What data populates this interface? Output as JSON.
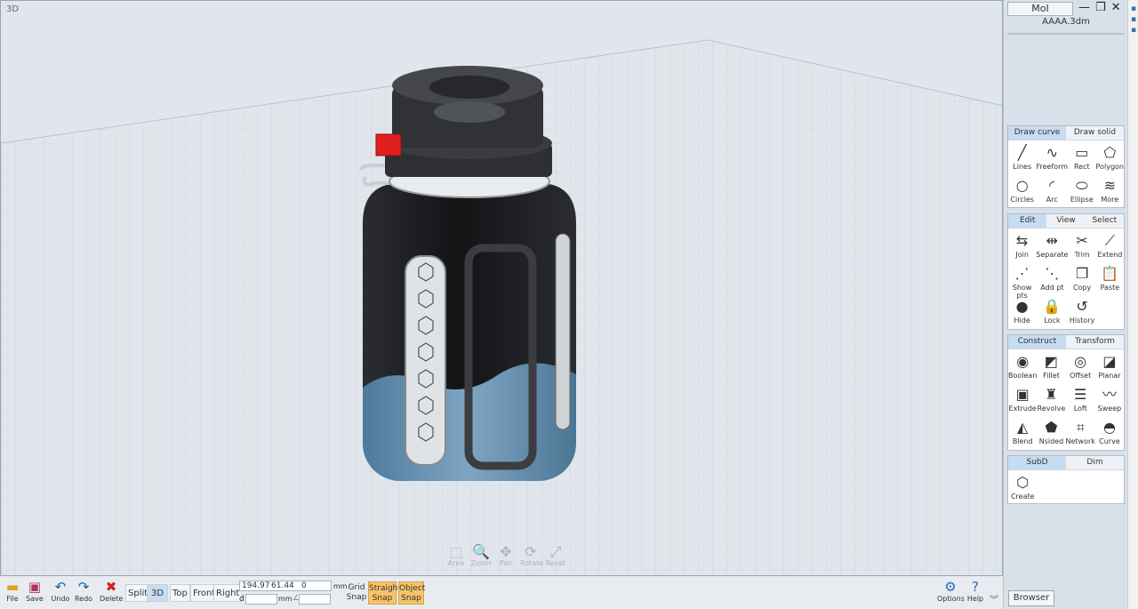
{
  "viewport": {
    "label": "3D"
  },
  "nav_tools": [
    {
      "id": "area",
      "label": "Area",
      "glyph": "⬚"
    },
    {
      "id": "zoom",
      "label": "Zoom",
      "glyph": "🔍"
    },
    {
      "id": "pan",
      "label": "Pan",
      "glyph": "✥"
    },
    {
      "id": "rotate",
      "label": "Rotate",
      "glyph": "⟳"
    },
    {
      "id": "reset",
      "label": "Reset",
      "glyph": "⤢"
    }
  ],
  "bottom": {
    "file": "File",
    "save": "Save",
    "undo": "Undo",
    "redo": "Redo",
    "delete": "Delete",
    "views": [
      "Split",
      "3D",
      "Top",
      "Front",
      "Right"
    ],
    "active_view": "3D",
    "coord_x": "194.97",
    "coord_y": "61.44",
    "coord_z": "0",
    "unit": "mm",
    "d_label": "d",
    "d_unit": "mm",
    "angle_symbol": "∠",
    "grid_snap": [
      "Grid",
      "Snap"
    ],
    "straight_snap": [
      "Straight",
      "Snap"
    ],
    "object_snap": [
      "Object",
      "Snap"
    ],
    "options": "Options",
    "help": "Help"
  },
  "side": {
    "app_title": "MoI",
    "filename": "AAAA.3dm",
    "draw": {
      "tabs": [
        "Draw curve",
        "Draw solid"
      ],
      "active": 0,
      "tools": [
        {
          "label": "Lines",
          "icon": "lines-icon",
          "glyph": "╱"
        },
        {
          "label": "Freeform",
          "icon": "freeform-icon",
          "glyph": "∿"
        },
        {
          "label": "Rect",
          "icon": "rect-icon",
          "glyph": "▭"
        },
        {
          "label": "Polygon",
          "icon": "polygon-icon",
          "glyph": "⬠"
        },
        {
          "label": "Circles",
          "icon": "circle-icon",
          "glyph": "○"
        },
        {
          "label": "Arc",
          "icon": "arc-icon",
          "glyph": "◜"
        },
        {
          "label": "Ellipse",
          "icon": "ellipse-icon",
          "glyph": "⬭"
        },
        {
          "label": "More",
          "icon": "more-icon",
          "glyph": "≋"
        }
      ]
    },
    "edit": {
      "tabs": [
        "Edit",
        "View",
        "Select"
      ],
      "active": 0,
      "tools": [
        {
          "label": "Join",
          "icon": "join-icon",
          "glyph": "⇆"
        },
        {
          "label": "Separate",
          "icon": "separate-icon",
          "glyph": "⇹"
        },
        {
          "label": "Trim",
          "icon": "trim-icon",
          "glyph": "✂"
        },
        {
          "label": "Extend",
          "icon": "extend-icon",
          "glyph": "⟋"
        },
        {
          "label": "Show pts",
          "icon": "show-points-icon",
          "glyph": "⋰"
        },
        {
          "label": "Add pt",
          "icon": "add-point-icon",
          "glyph": "⋱"
        },
        {
          "label": "Copy",
          "icon": "copy-icon",
          "glyph": "❐"
        },
        {
          "label": "Paste",
          "icon": "paste-icon",
          "glyph": "📋"
        },
        {
          "label": "Hide",
          "icon": "hide-icon",
          "glyph": "●"
        },
        {
          "label": "Lock",
          "icon": "lock-icon",
          "glyph": "🔒"
        },
        {
          "label": "History",
          "icon": "history-icon",
          "glyph": "↺"
        }
      ]
    },
    "construct": {
      "tabs": [
        "Construct",
        "Transform"
      ],
      "active": 0,
      "tools": [
        {
          "label": "Boolean",
          "icon": "boolean-icon",
          "glyph": "◉"
        },
        {
          "label": "Fillet",
          "icon": "fillet-icon",
          "glyph": "◩"
        },
        {
          "label": "Offset",
          "icon": "offset-icon",
          "glyph": "◎"
        },
        {
          "label": "Planar",
          "icon": "planar-icon",
          "glyph": "◪"
        },
        {
          "label": "Extrude",
          "icon": "extrude-icon",
          "glyph": "▣"
        },
        {
          "label": "Revolve",
          "icon": "revolve-icon",
          "glyph": "♜"
        },
        {
          "label": "Loft",
          "icon": "loft-icon",
          "glyph": "☰"
        },
        {
          "label": "Sweep",
          "icon": "sweep-icon",
          "glyph": "〰"
        },
        {
          "label": "Blend",
          "icon": "blend-icon",
          "glyph": "◭"
        },
        {
          "label": "Nsided",
          "icon": "nsided-icon",
          "glyph": "⬟"
        },
        {
          "label": "Network",
          "icon": "network-icon",
          "glyph": "⌗"
        },
        {
          "label": "Curve",
          "icon": "curve-icon",
          "glyph": "◓"
        }
      ]
    },
    "subd": {
      "tabs": [
        "SubD",
        "Dim"
      ],
      "active": 0,
      "tools": [
        {
          "label": "Create",
          "icon": "subd-create-icon",
          "glyph": "⬡"
        }
      ]
    },
    "browser": "Browser"
  },
  "colors": {
    "accent_tab": "#c6dcf2",
    "snap_on": "#f6c36a",
    "viewport_bg": "#e1e6ec",
    "bottle_dark": "#1b1d20",
    "bottle_blue": "#6f95b2",
    "cap_red": "#e0201e"
  }
}
